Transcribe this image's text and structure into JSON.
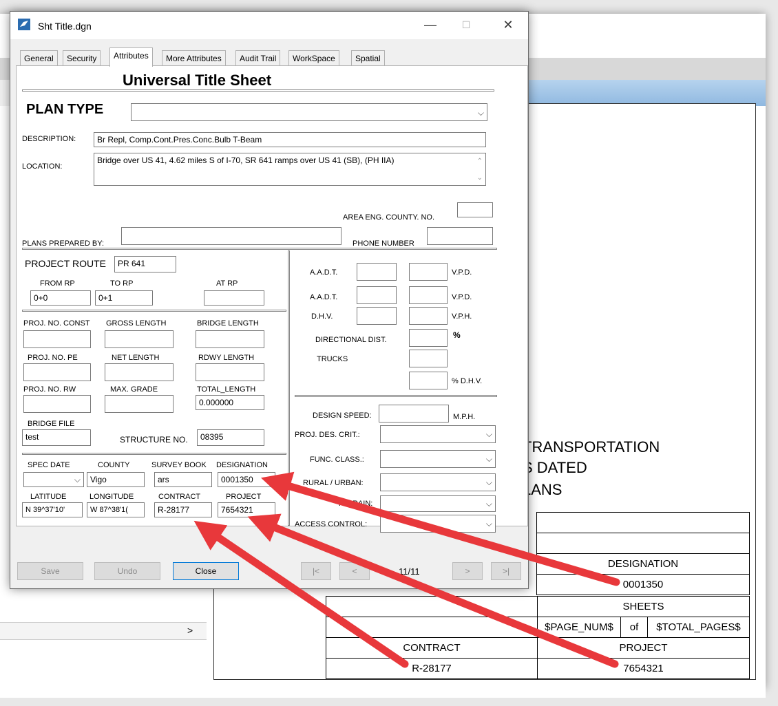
{
  "window": {
    "title": "Sht Title.dgn",
    "minimize": "—",
    "maximize": "☐",
    "close": "✕"
  },
  "tabs": [
    "General",
    "Security",
    "Attributes",
    "More Attributes",
    "Audit Trail",
    "WorkSpace",
    "Spatial"
  ],
  "active_tab": "Attributes",
  "form": {
    "heading": "Universal Title Sheet",
    "plan_type_label": "PLAN TYPE",
    "plan_type_value": "",
    "description_label": "DESCRIPTION:",
    "description_value": "Br Repl, Comp.Cont.Pres.Conc.Bulb T-Beam",
    "location_label": "LOCATION:",
    "location_value": "Bridge over US 41, 4.62 miles S of I-70, SR 641 ramps over US 41 (SB), (PH IIA)",
    "area_eng_label": "AREA ENG. COUNTY. NO.",
    "plans_prepared_label": "PLANS PREPARED BY:",
    "phone_label": "PHONE NUMBER",
    "project_route_label": "PROJECT ROUTE",
    "project_route_value": "PR 641",
    "from_rp_label": "FROM RP",
    "from_rp_value": "0+0",
    "to_rp_label": "TO RP",
    "to_rp_value": "0+1",
    "at_rp_label": "AT RP",
    "proj_no_const_label": "PROJ. NO. CONST",
    "gross_length_label": "GROSS LENGTH",
    "bridge_length_label": "BRIDGE LENGTH",
    "proj_no_pe_label": "PROJ. NO. PE",
    "net_length_label": "NET LENGTH",
    "rdwy_length_label": "RDWY LENGTH",
    "proj_no_rw_label": "PROJ. NO. RW",
    "max_grade_label": "MAX. GRADE",
    "total_length_label": "TOTAL_LENGTH",
    "total_length_value": "0.000000",
    "bridge_file_label": "BRIDGE FILE",
    "bridge_file_value": "test",
    "structure_no_label": "STRUCTURE NO.",
    "structure_no_value": "08395",
    "spec_date_label": "SPEC DATE",
    "county_label": "COUNTY",
    "county_value": "Vigo",
    "survey_book_label": "SURVEY BOOK",
    "survey_book_value": "ars",
    "designation_label": "DESIGNATION",
    "designation_value": "0001350",
    "latitude_label": "LATITUDE",
    "latitude_value": "N 39^37'10'",
    "longitude_label": "LONGITUDE",
    "longitude_value": "W  87^38'1(",
    "contract_label": "CONTRACT",
    "contract_value": "R-28177",
    "project_label": "PROJECT",
    "project_value": "7654321",
    "aadt_label": "A.A.D.T.",
    "vpd_label": "V.P.D.",
    "dhv_label": "D.H.V.",
    "vph_label": "V.P.H.",
    "directional_label": "DIRECTIONAL DIST.",
    "percent_label": "%",
    "trucks_label": "TRUCKS",
    "pct_dhv_label": "% D.H.V.",
    "design_speed_label": "DESIGN SPEED:",
    "mph_label": "M.P.H.",
    "proj_des_crit_label": "PROJ. DES. CRIT.:",
    "func_class_label": "FUNC. CLASS.:",
    "rural_urban_label": "RURAL / URBAN:",
    "terrain_label": "TERRAIN:",
    "access_control_label": "ACCESS CONTROL:"
  },
  "buttons": {
    "save": "Save",
    "undo": "Undo",
    "close": "Close",
    "first": "|<",
    "prev": "<",
    "page": "11/11",
    "next": ">",
    "last": ">|"
  },
  "sheet": {
    "line1": "TRANSPORTATION",
    "line2": "S DATED",
    "line3": "LANS",
    "designation_header": "DESIGNATION",
    "designation_value": "0001350",
    "sheets_header": "SHEETS",
    "page_num": "$PAGE_NUM$",
    "of": "of",
    "total_pages": "$TOTAL_PAGES$",
    "contract_header": "CONTRACT",
    "contract_value": "R-28177",
    "project_header": "PROJECT",
    "project_value": "7654321"
  },
  "left_panel": {
    "scroll_right": ">"
  },
  "colors": {
    "arrow": "#e8383b",
    "accent_blue": "#0078d7"
  }
}
